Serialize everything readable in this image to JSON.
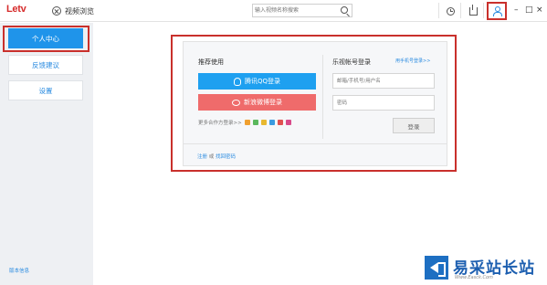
{
  "topbar": {
    "logo_text": "Letv",
    "nav_video_label": "视频浏览",
    "nav_icon": "close-circle-icon",
    "search_placeholder": "输入视频名称搜索",
    "icons": [
      "search-icon",
      "history-icon",
      "download-icon",
      "user-icon",
      "minimize-icon",
      "maximize-icon",
      "close-icon"
    ],
    "min_glyph": "–",
    "max_glyph": "□",
    "close_glyph": "×"
  },
  "sidebar": {
    "items": [
      {
        "label": "个人中心",
        "active": true
      },
      {
        "label": "反馈建议",
        "active": false
      },
      {
        "label": "设置",
        "active": false
      }
    ],
    "version_label": "版本信息"
  },
  "login": {
    "left_title": "推荐使用",
    "qq_label": "腾讯QQ登录",
    "weibo_label": "新浪微博登录",
    "more_label": "更多合作方登录>>",
    "right_title": "乐视帐号登录",
    "phone_login_link": "用手机号登录>>",
    "username_placeholder": "邮箱/手机号/用户名",
    "password_placeholder": "密码",
    "login_button": "登录",
    "register_link": "注册",
    "or_text": "或",
    "forgot_link": "找回密码"
  },
  "colors": {
    "accent": "#1f94ea",
    "qq": "#1ea0f0",
    "weibo": "#ef6b6b",
    "highlight": "#c9302c",
    "brand": "#d62b2b"
  },
  "watermark": {
    "title": "易采站长站",
    "subtitle": "Www.Easck.Com"
  }
}
